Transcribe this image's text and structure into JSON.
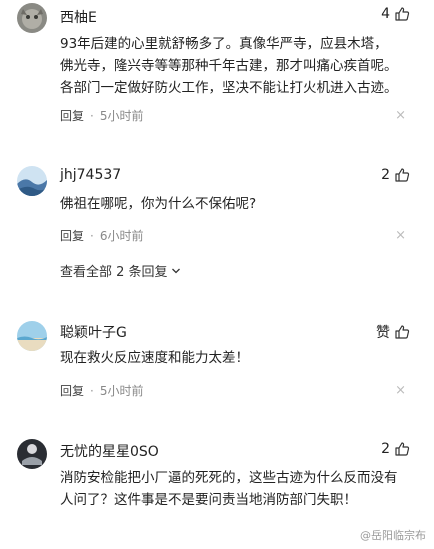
{
  "comments": [
    {
      "username": "西柚E",
      "likes": "4",
      "text": "93年后建的心里就舒畅多了。真像华严寺，应县木塔，\n佛光寺，隆兴寺等等那种千年古建，那才叫痛心疾首呢。\n各部门一定做好防火工作，坚决不能让打火机进入古迹。",
      "reply_label": "回复",
      "time": "5小时前"
    },
    {
      "username": "jhj74537",
      "likes": "2",
      "text": "佛祖在哪呢，你为什么不保佑呢?",
      "reply_label": "回复",
      "time": "6小时前",
      "view_all": "查看全部 2 条回复"
    },
    {
      "username": "聪颖叶子G",
      "likes": "赞",
      "text": "现在救火反应速度和能力太差！",
      "reply_label": "回复",
      "time": "5小时前"
    },
    {
      "username": "无忧的星星0SO",
      "likes": "2",
      "text": "消防安检能把小厂逼的死死的，这些古迹为什么反而没有\n人问了？这件事是不是要问责当地消防部门失职！",
      "reply_label": "回复",
      "time": "5小时前"
    }
  ],
  "close_glyph": "×",
  "watermark": "@岳阳临宗布"
}
